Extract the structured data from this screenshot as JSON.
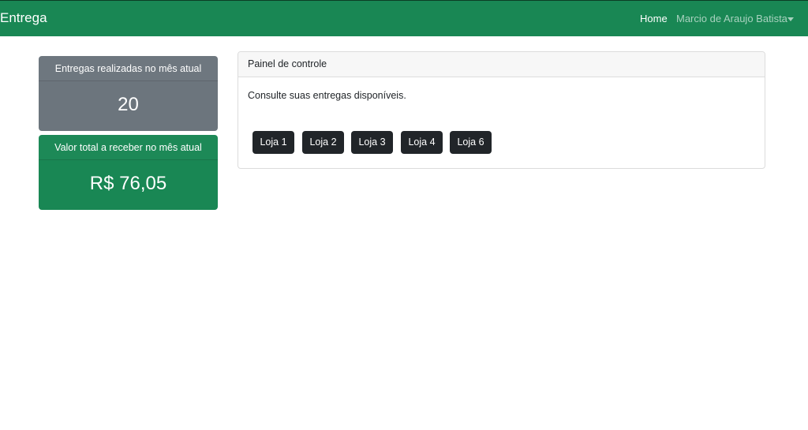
{
  "navbar": {
    "brand": "Entrega",
    "home_label": "Home",
    "user_label": "Marcio de Araujo Batista",
    "background_color": "#198754"
  },
  "stats": {
    "deliveries": {
      "header": "Entregas realizadas no mês atual",
      "value": "20",
      "color": "#6c757d"
    },
    "total_value": {
      "header": "Valor total a receber no mês atual",
      "value": "R$ 76,05",
      "color": "#198754"
    }
  },
  "panel": {
    "header": "Painel de controle",
    "text": "Consulte suas entregas disponíveis.",
    "buttons": [
      "Loja 1",
      "Loja 2",
      "Loja 3",
      "Loja 4",
      "Loja 6"
    ]
  }
}
